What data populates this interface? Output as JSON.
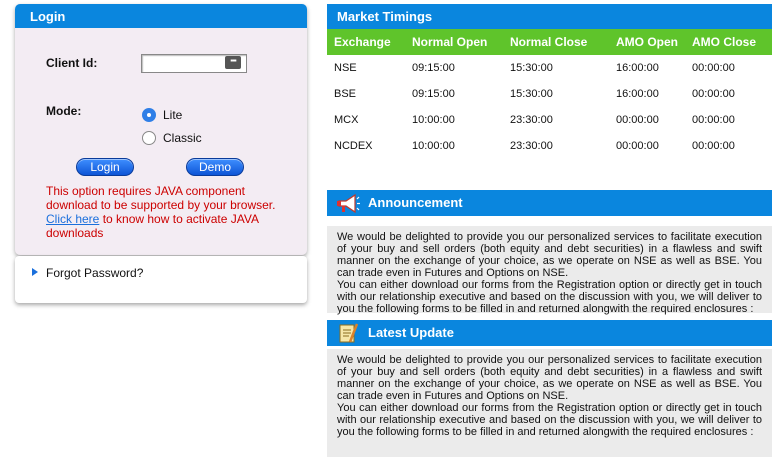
{
  "login": {
    "title": "Login",
    "client_id_label": "Client Id:",
    "client_id_value": "",
    "mode_label": "Mode:",
    "mode_options": [
      "Lite",
      "Classic"
    ],
    "mode_selected": "Lite",
    "login_button": "Login",
    "demo_button": "Demo",
    "java_message_1": "This option requires JAVA component download to be supported by your browser.",
    "java_link": "Click here",
    "java_message_2": " to know how to activate JAVA downloads"
  },
  "forgot": {
    "label": "Forgot Password?"
  },
  "market": {
    "title": "Market Timings",
    "columns": [
      "Exchange",
      "Normal Open",
      "Normal Close",
      "AMO Open",
      "AMO Close"
    ],
    "rows": [
      [
        "NSE",
        "09:15:00",
        "15:30:00",
        "16:00:00",
        "00:00:00"
      ],
      [
        "BSE",
        "09:15:00",
        "15:30:00",
        "16:00:00",
        "00:00:00"
      ],
      [
        "MCX",
        "10:00:00",
        "23:30:00",
        "00:00:00",
        "00:00:00"
      ],
      [
        "NCDEX",
        "10:00:00",
        "23:30:00",
        "00:00:00",
        "00:00:00"
      ]
    ]
  },
  "announcement": {
    "title": "Announcement",
    "para1": "We would be delighted to provide you our personalized services to facilitate execution of your buy and sell orders (both equity and debt securities) in a flawless and swift manner on the exchange of your choice, as we operate on NSE as well as BSE. You can trade even in Futures and Options on NSE.",
    "para2": "You can either download our forms from the Registration option or directly get in touch with our relationship executive and based on the discussion with you, we will deliver to you the following forms to be filled in and returned alongwith the required enclosures :"
  },
  "latest_update": {
    "title": "Latest Update",
    "para1": "We would be delighted to provide you our personalized services to facilitate execution of your buy and sell orders (both equity and debt securities) in a flawless and swift manner on the exchange of your choice, as we operate on NSE as well as BSE. You can trade even in Futures and Options on NSE.",
    "para2": "You can either download our forms from the Registration option or directly get in touch with our relationship executive and based on the discussion with you, we will deliver to you the following forms to be filled in and returned alongwith the required enclosures :"
  },
  "colors": {
    "header_blue": "#0a86de",
    "table_header_green": "#5fc42b",
    "error_red": "#cc0000",
    "link_blue": "#1a6fdc"
  }
}
